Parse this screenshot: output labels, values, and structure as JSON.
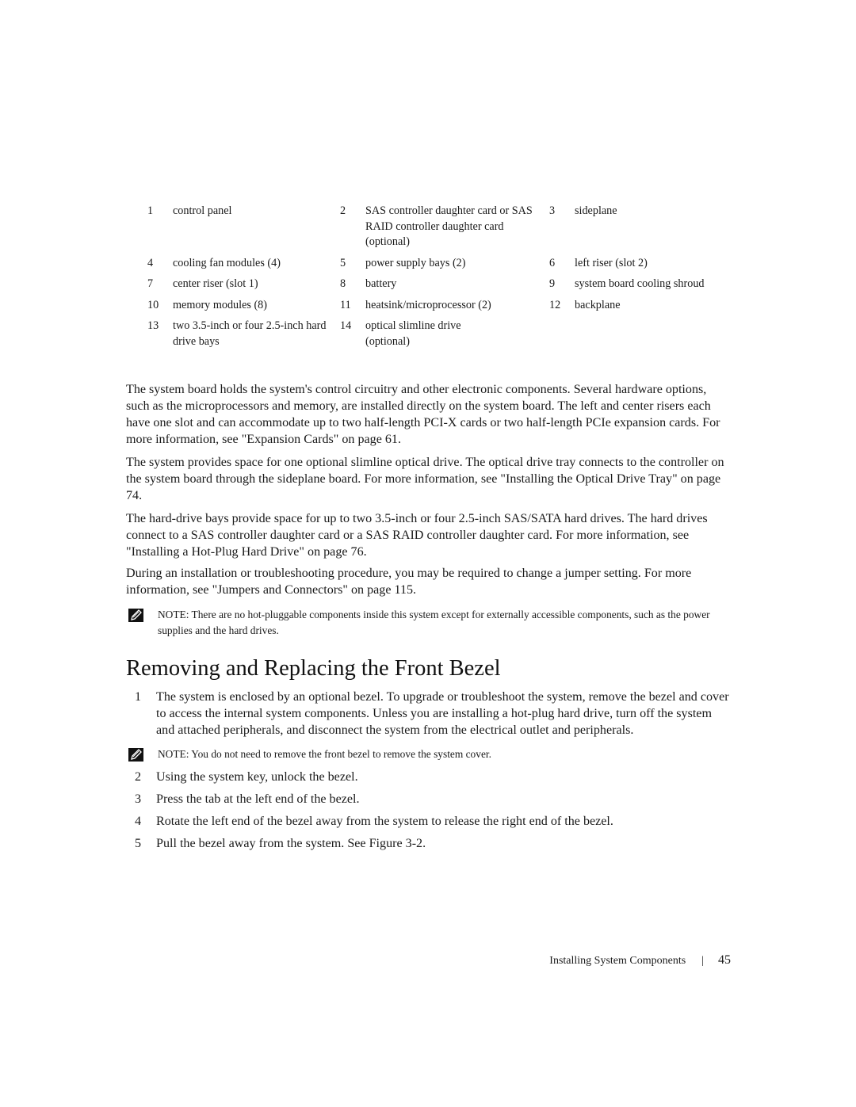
{
  "legend": [
    [
      {
        "num": "1",
        "label": "control panel"
      },
      {
        "num": "2",
        "label": "SAS controller daughter card or SAS RAID controller daughter card (optional)"
      },
      {
        "num": "3",
        "label": "sideplane"
      }
    ],
    [
      {
        "num": "4",
        "label": "cooling fan modules (4)"
      },
      {
        "num": "5",
        "label": "power supply bays (2)"
      },
      {
        "num": "6",
        "label": "left riser (slot 2)"
      }
    ],
    [
      {
        "num": "7",
        "label": "center riser (slot 1)"
      },
      {
        "num": "8",
        "label": "battery"
      },
      {
        "num": "9",
        "label": "system board cooling shroud"
      }
    ],
    [
      {
        "num": "10",
        "label": "memory modules (8)"
      },
      {
        "num": "11",
        "label": "heatsink/microprocessor (2)"
      },
      {
        "num": "12",
        "label": "backplane"
      }
    ],
    [
      {
        "num": "13",
        "label": "two 3.5-inch or four 2.5-inch hard drive bays"
      },
      {
        "num": "14",
        "label": "optical slimline drive (optional)"
      },
      {
        "num": "",
        "label": ""
      }
    ]
  ],
  "paragraphs": [
    "The system board holds the system's control circuitry and other electronic components. Several hardware options, such as the microprocessors and memory, are installed directly on the system board. The left and center risers each have one slot and can accommodate up to two half-length PCI-X cards or two half-length PCIe expansion cards. For more information, see \"Expansion Cards\" on page 61.",
    "The system provides space for one optional slimline optical drive. The optical drive tray connects to the controller on the system board through the sideplane board. For more information, see \"Installing the Optical Drive Tray\" on page 74.",
    "The hard-drive bays provide space for up to two 3.5-inch or four 2.5-inch SAS/SATA hard drives. The hard drives connect to a SAS controller daughter card or a SAS RAID controller daughter card. For more information, see \"Installing a Hot-Plug Hard Drive\" on page 76.",
    "During an installation or troubleshooting procedure, you may be required to change a jumper setting. For more information, see \"Jumpers and Connectors\" on page 115."
  ],
  "notes": [
    "NOTE: There are no hot-pluggable components inside this system except for externally accessible components, such as the power supplies and the hard drives.",
    "NOTE: You do not need to remove the front bezel to remove the system cover."
  ],
  "section": {
    "heading": "Removing and Replacing the Front Bezel",
    "steps": [
      {
        "num": "1",
        "text": "The system is enclosed by an optional bezel. To upgrade or troubleshoot the system, remove the bezel and cover to access the internal system components. Unless you are installing a hot-plug hard drive, turn off the system and attached peripherals, and disconnect the system from the electrical outlet and peripherals."
      },
      {
        "num": "2",
        "text": "Using the system key, unlock the bezel."
      },
      {
        "num": "3",
        "text": "Press the tab at the left end of the bezel."
      },
      {
        "num": "4",
        "text": "Rotate the left end of the bezel away from the system to release the right end of the bezel."
      },
      {
        "num": "5",
        "text": "Pull the bezel away from the system. See Figure 3-2."
      }
    ]
  },
  "footer": {
    "section_title": "Installing System Components",
    "separator": "|",
    "page_number": "45"
  }
}
